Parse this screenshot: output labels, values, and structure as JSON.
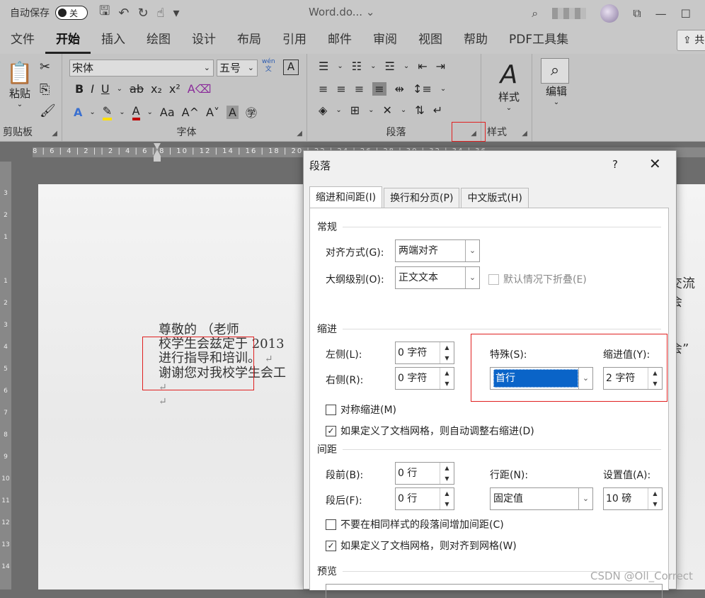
{
  "titlebar": {
    "autosave": "自动保存",
    "toggle": "关",
    "doc": "Word.do...",
    "dropdown": "⌄"
  },
  "menu": {
    "tabs": [
      "文件",
      "开始",
      "插入",
      "绘图",
      "设计",
      "布局",
      "引用",
      "邮件",
      "审阅",
      "视图",
      "帮助",
      "PDF工具集"
    ],
    "share": "共"
  },
  "ribbon": {
    "clipboard": {
      "paste": "粘贴",
      "label": "剪贴板"
    },
    "font": {
      "name": "宋体",
      "size": "五号",
      "wen": "wén",
      "wen2": "文",
      "label": "字体",
      "aa": "Aa",
      "A_up": "A^",
      "A_down": "A˅"
    },
    "paragraph": {
      "label": "段落"
    },
    "styles": {
      "btn": "样式",
      "label": "样式"
    },
    "editing": {
      "btn": "编辑"
    }
  },
  "ruler": {
    "top": "8 | 6 | 4 | 2 |  | 2 | 4 | 6 | 8 | 10 | 12 | 14 | 16 | 18 | 20 | 22 | 24 | 26 | 28 | 30 | 32 | 34 | 36",
    "left": [
      "3",
      "2",
      "1",
      "",
      "1",
      "2",
      "3",
      "4",
      "5",
      "6",
      "7",
      "8",
      "9",
      "10",
      "11",
      "12",
      "13",
      "14"
    ]
  },
  "doc": {
    "line1": "尊敬的         （老师",
    "line2": "校学生会兹定于 2013",
    "line3": "进行指导和培训。",
    "line4": "谢谢您对我校学生会工",
    "pmark": "↵",
    "right1": "交流会",
    "right2": "会”"
  },
  "dialog": {
    "title": "段落",
    "help": "?",
    "close": "✕",
    "tabs": [
      "缩进和间距(I)",
      "换行和分页(P)",
      "中文版式(H)"
    ],
    "general": {
      "heading": "常规",
      "align_label": "对齐方式(G):",
      "align_value": "两端对齐",
      "outline_label": "大纲级别(O):",
      "outline_value": "正文文本",
      "collapse": "默认情况下折叠(E)"
    },
    "indent": {
      "heading": "缩进",
      "left_label": "左侧(L):",
      "left_value": "0 字符",
      "right_label": "右侧(R):",
      "right_value": "0 字符",
      "special_label": "特殊(S):",
      "special_value": "首行",
      "by_label": "缩进值(Y):",
      "by_value": "2 字符",
      "mirror": "对称缩进(M)",
      "auto_adjust": "如果定义了文档网格，则自动调整右缩进(D)"
    },
    "spacing": {
      "heading": "间距",
      "before_label": "段前(B):",
      "before_value": "0 行",
      "after_label": "段后(F):",
      "after_value": "0 行",
      "line_label": "行距(N):",
      "line_value": "固定值",
      "at_label": "设置值(A):",
      "at_value": "10 磅",
      "no_space": "不要在相同样式的段落间增加间距(C)",
      "snap": "如果定义了文档网格，则对齐到网格(W)"
    },
    "preview": {
      "heading": "预览"
    }
  },
  "watermark": "CSDN @Oll_Correct"
}
